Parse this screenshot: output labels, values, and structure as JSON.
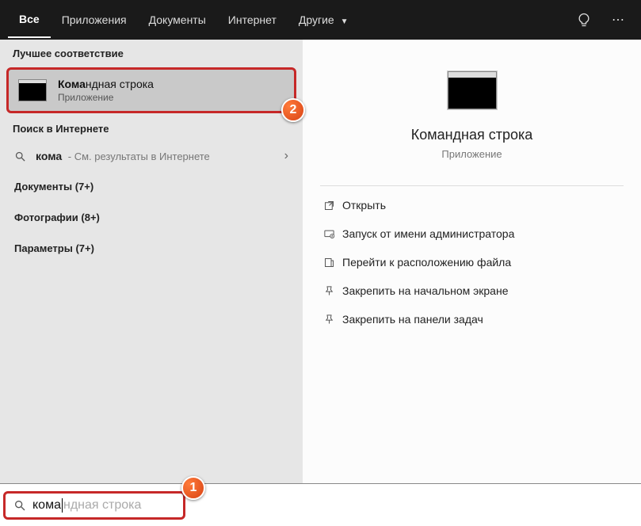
{
  "tabs": {
    "all": "Все",
    "apps": "Приложения",
    "docs": "Документы",
    "web": "Интернет",
    "more": "Другие"
  },
  "left": {
    "best_header": "Лучшее соответствие",
    "best_match": {
      "prefix": "Кома",
      "rest": "ндная строка",
      "sub": "Приложение"
    },
    "web_header": "Поиск в Интернете",
    "web_query": {
      "prefix": "кома",
      "hint": " - См. результаты в Интернете"
    },
    "cats": {
      "docs": "Документы (7+)",
      "photos": "Фотографии (8+)",
      "settings": "Параметры (7+)"
    }
  },
  "preview": {
    "title": "Командная строка",
    "sub": "Приложение",
    "actions": {
      "open": "Открыть",
      "admin": "Запуск от имени администратора",
      "location": "Перейти к расположению файла",
      "pin_start": "Закрепить на начальном экране",
      "pin_taskbar": "Закрепить на панели задач"
    }
  },
  "search": {
    "typed": "кома",
    "ghost": "ндная строка"
  },
  "badges": {
    "one": "1",
    "two": "2"
  }
}
